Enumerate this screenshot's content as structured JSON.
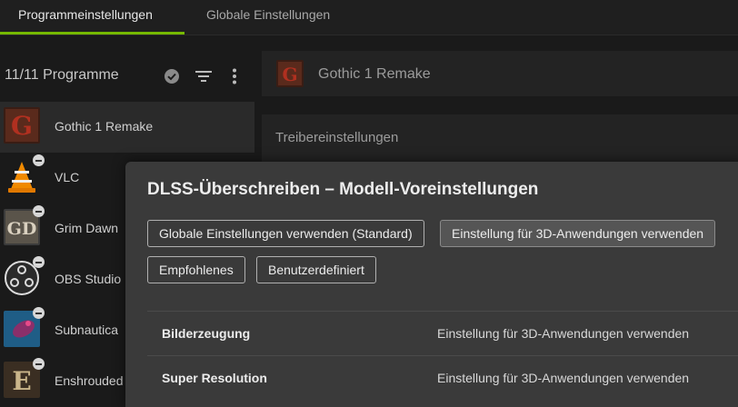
{
  "tabs": [
    {
      "label": "Programmeinstellungen",
      "active": true
    },
    {
      "label": "Globale Einstellungen",
      "active": false
    }
  ],
  "sidebar": {
    "title": "11/11 Programme",
    "icons": [
      "verified-check-icon",
      "filter-icon",
      "more-vertical-icon"
    ],
    "programs": [
      {
        "name": "Gothic 1 Remake",
        "icon": "gothic-remake-icon",
        "selected": true,
        "badge": false
      },
      {
        "name": "VLC",
        "icon": "vlc-icon",
        "selected": false,
        "badge": true
      },
      {
        "name": "Grim Dawn",
        "icon": "grim-dawn-icon",
        "selected": false,
        "badge": true
      },
      {
        "name": "OBS Studio",
        "icon": "obs-studio-icon",
        "selected": false,
        "badge": true
      },
      {
        "name": "Subnautica",
        "icon": "subnautica-icon",
        "selected": false,
        "badge": true
      },
      {
        "name": "Enshrouded",
        "icon": "enshrouded-icon",
        "selected": false,
        "badge": true
      }
    ]
  },
  "main": {
    "program_name": "Gothic 1 Remake",
    "section_title": "Treibereinstellungen"
  },
  "dialog": {
    "title": "DLSS-Überschreiben – Modell-Voreinstellungen",
    "options": [
      {
        "label": "Globale Einstellungen verwenden (Standard)",
        "active": false
      },
      {
        "label": "Einstellung für 3D-Anwendungen verwenden",
        "active": true
      },
      {
        "label": "Empfohlenes",
        "active": false
      },
      {
        "label": "Benutzerdefiniert",
        "active": false
      }
    ],
    "rows": [
      {
        "label": "Bilderzeugung",
        "value": "Einstellung für 3D-Anwendungen verwenden"
      },
      {
        "label": "Super Resolution",
        "value": "Einstellung für 3D-Anwendungen verwenden"
      }
    ]
  },
  "colors": {
    "accent": "#76b900"
  }
}
